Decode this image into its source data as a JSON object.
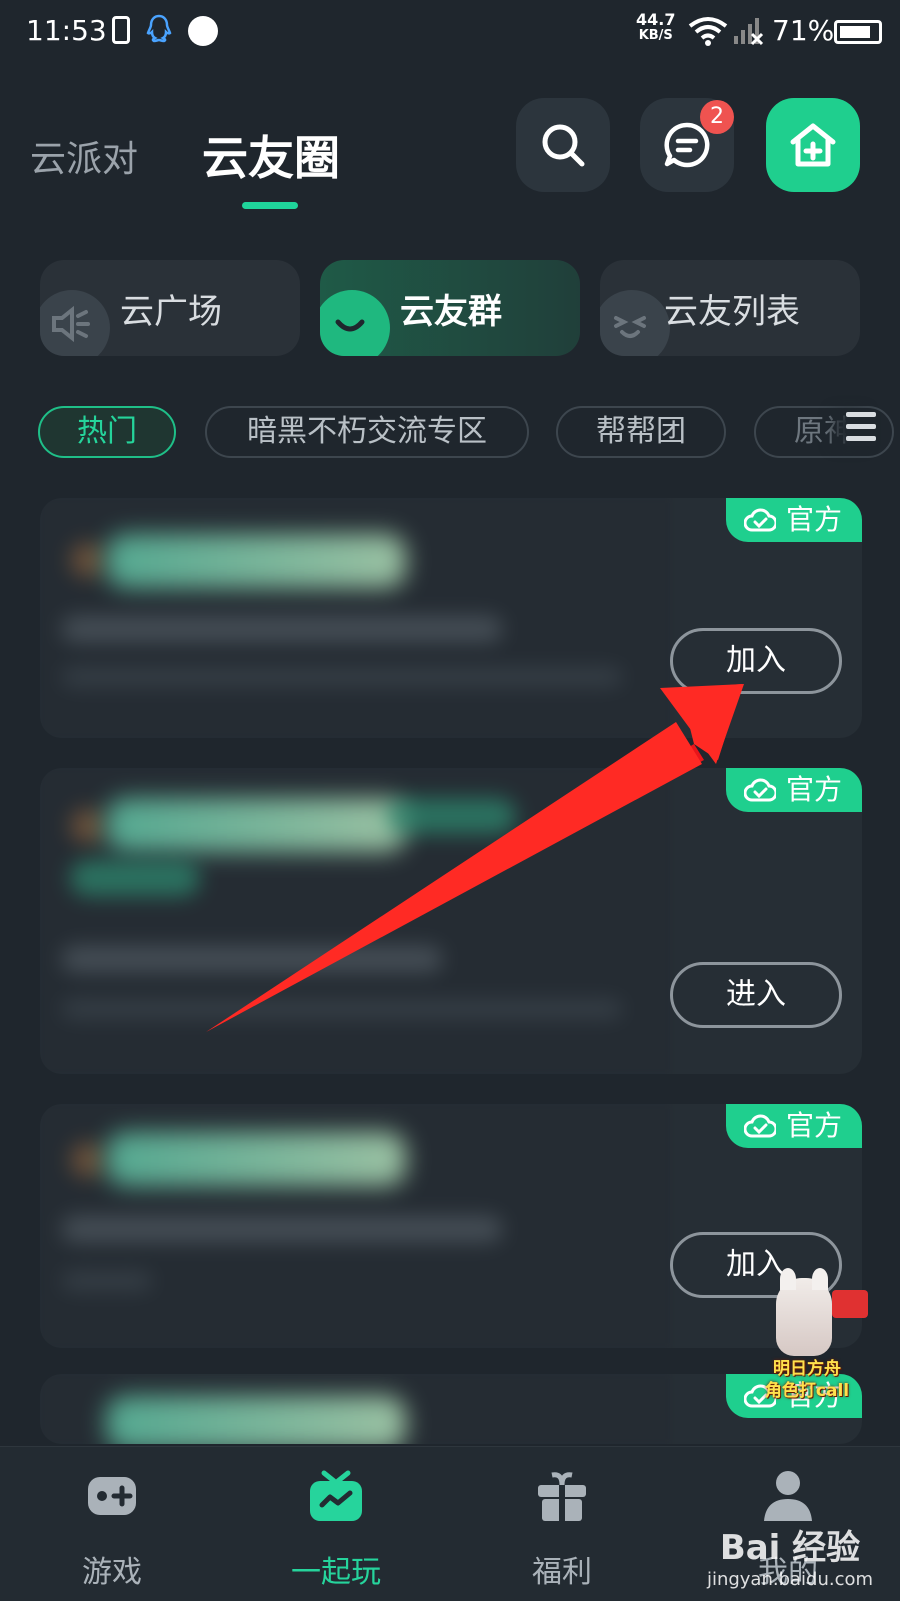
{
  "status_bar": {
    "time": "11:53",
    "net_speed_value": "44.7",
    "net_speed_unit": "KB/S",
    "battery_percent": "71%"
  },
  "header": {
    "tabs": [
      {
        "label": "云派对",
        "active": false
      },
      {
        "label": "云友圈",
        "active": true
      }
    ],
    "message_badge": "2",
    "accent_color": "#1fcf8e"
  },
  "categories": [
    {
      "label": "云广场",
      "icon": "speaker-icon"
    },
    {
      "label": "云友群",
      "icon": "cloud-smile-icon",
      "active": true
    },
    {
      "label": "云友列表",
      "icon": "face-icon"
    }
  ],
  "filters": [
    {
      "label": "热门",
      "active": true
    },
    {
      "label": "暗黑不朽交流专区"
    },
    {
      "label": "帮帮团"
    },
    {
      "label": "原神"
    }
  ],
  "groups": [
    {
      "badge": "官方",
      "action": "加入"
    },
    {
      "badge": "官方",
      "action": "进入"
    },
    {
      "badge": "官方",
      "action": "加入"
    },
    {
      "badge": "官方"
    }
  ],
  "promo": {
    "line1": "明日方舟",
    "line2": "角色打call"
  },
  "bottom_nav": [
    {
      "label": "游戏",
      "icon": "gamepad-icon"
    },
    {
      "label": "一起玩",
      "icon": "tv-icon",
      "active": true
    },
    {
      "label": "福利",
      "icon": "gift-icon"
    },
    {
      "label": "我的",
      "icon": "person-icon"
    }
  ],
  "watermark": {
    "brand": "Bai 经验",
    "url": "jingyan.baidu.com"
  }
}
